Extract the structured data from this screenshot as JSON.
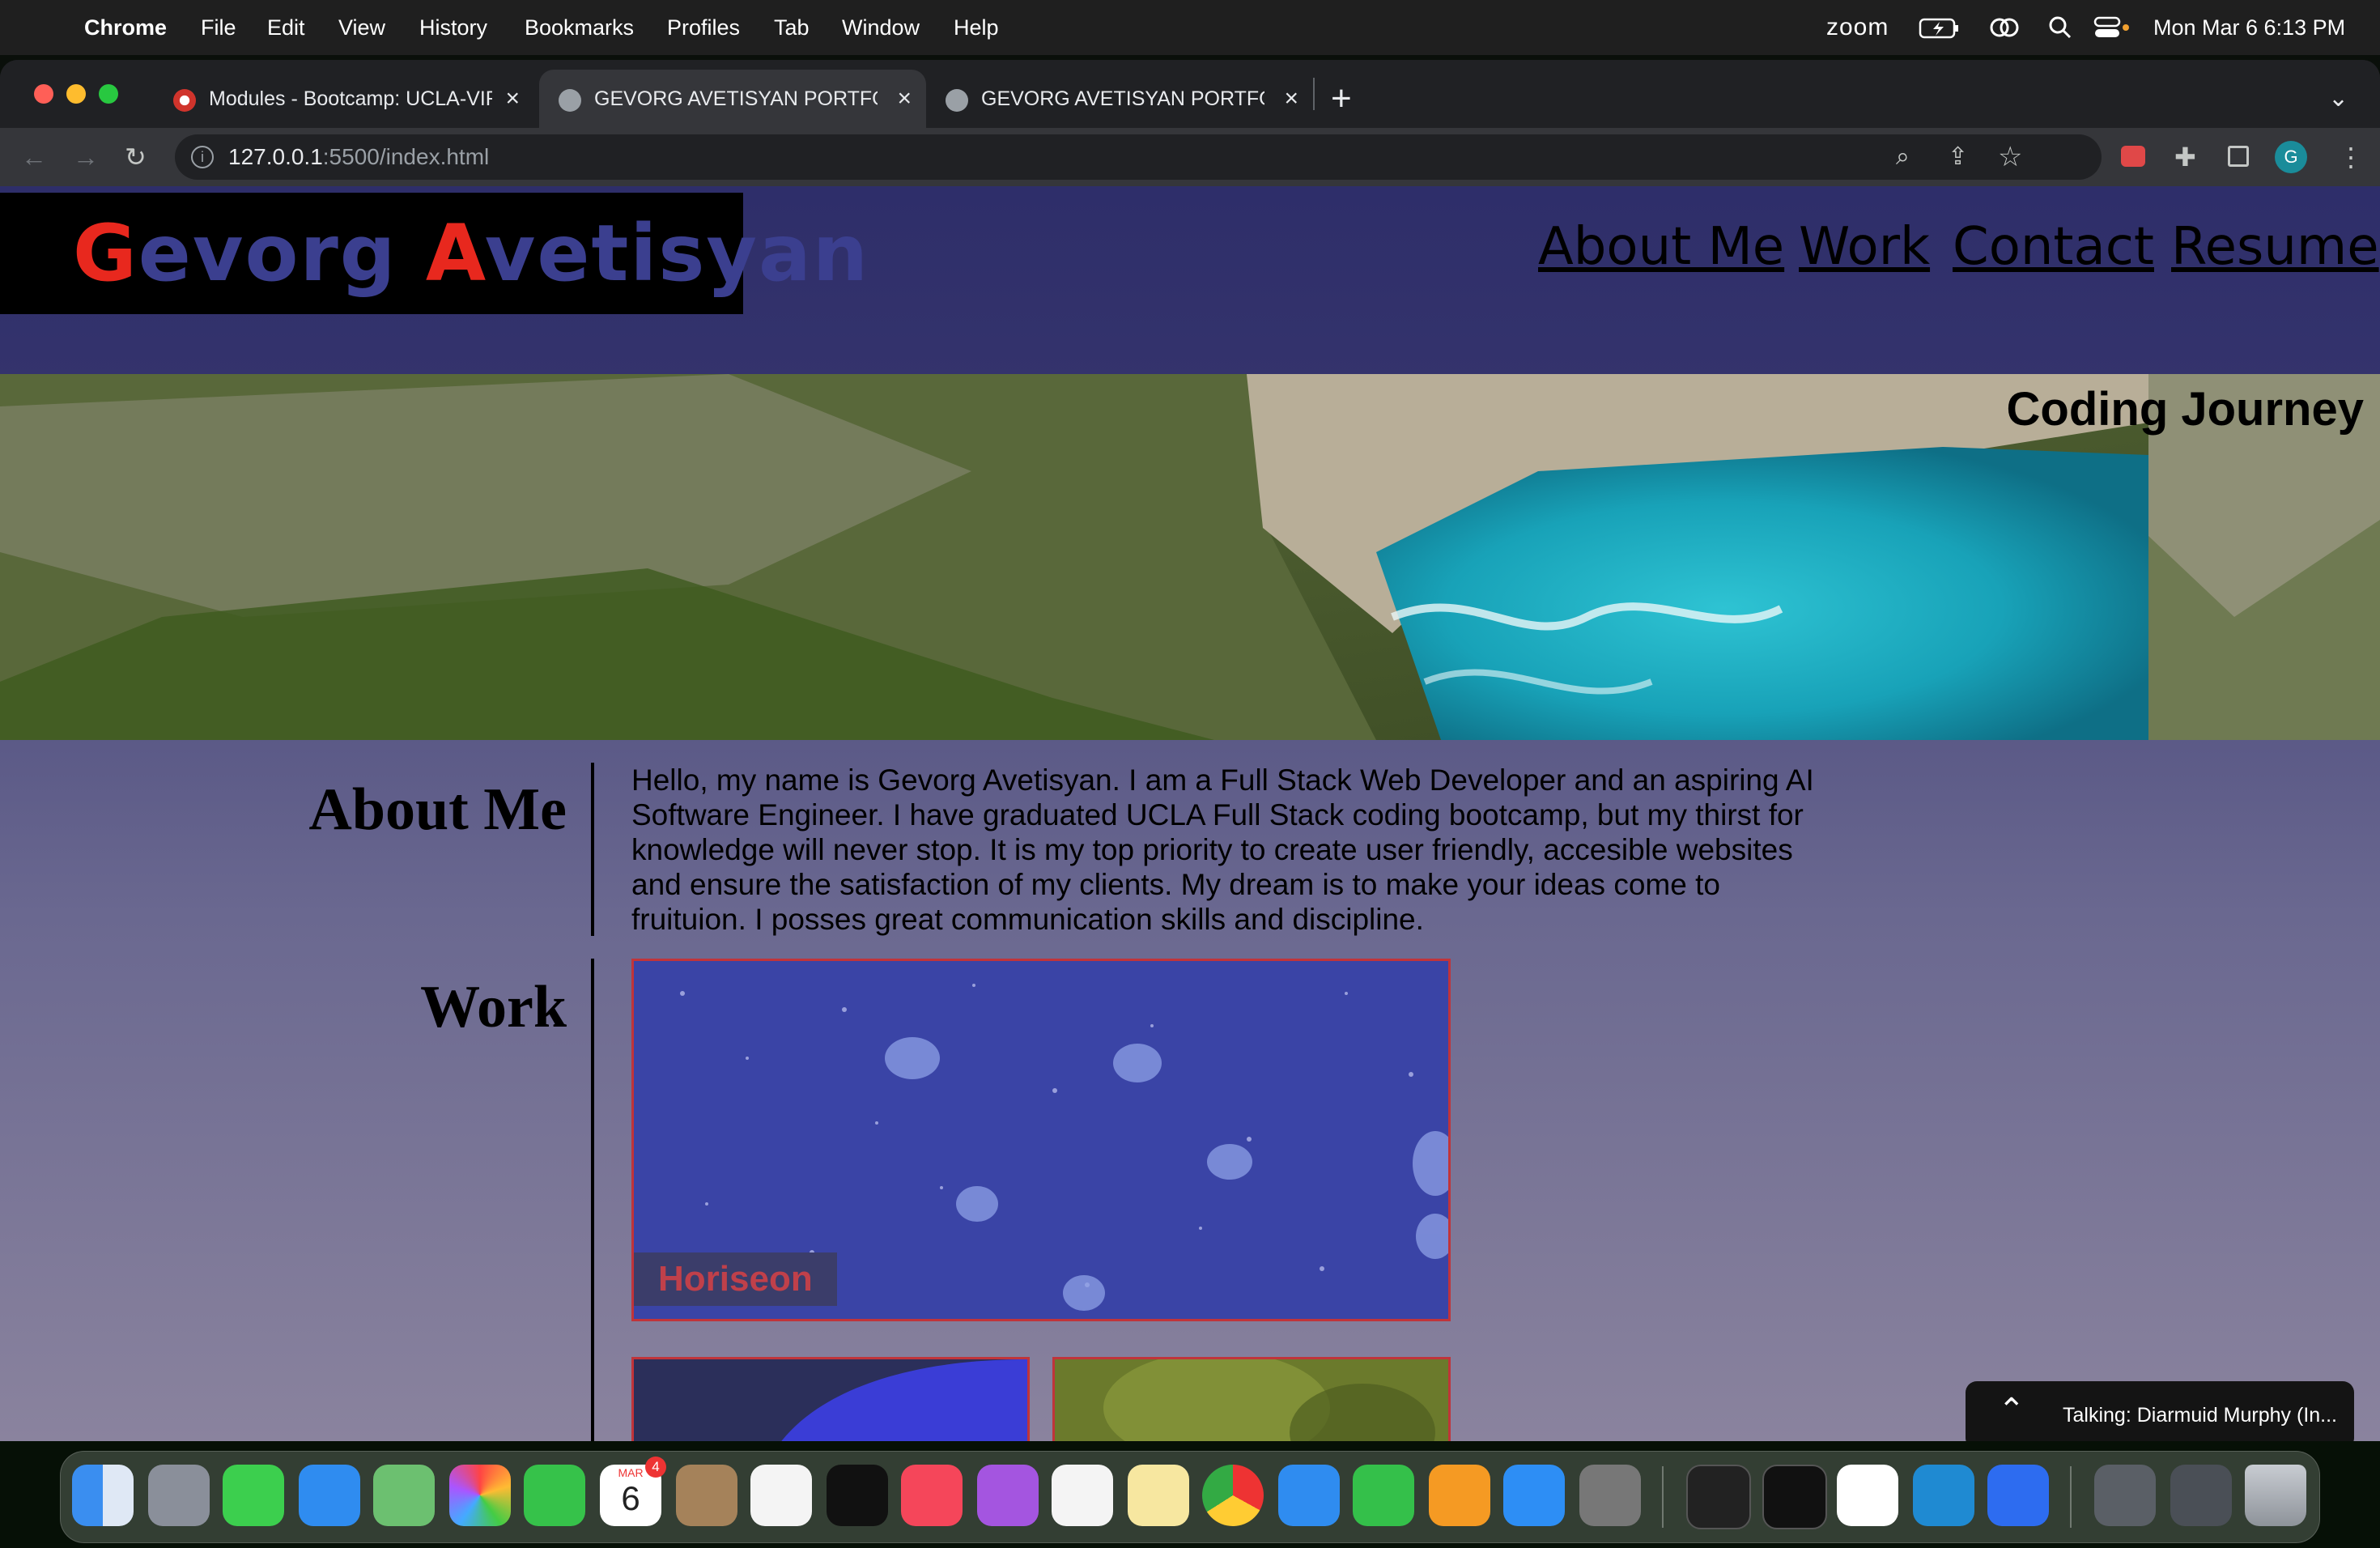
{
  "menubar": {
    "app": "Chrome",
    "items": [
      "File",
      "Edit",
      "View",
      "History",
      "Bookmarks",
      "Profiles",
      "Tab",
      "Window",
      "Help"
    ],
    "zoom_label": "zoom",
    "datetime": "Mon Mar 6  6:13 PM"
  },
  "browser": {
    "tabs": [
      {
        "title": "Modules - Bootcamp: UCLA-VIRT",
        "active": false
      },
      {
        "title": "GEVORG AVETISYAN PORTFOLIO",
        "active": true
      },
      {
        "title": "GEVORG AVETISYAN PORTFOLIO",
        "active": false
      }
    ],
    "new_tab": "+",
    "url_host": "127.0.0.1",
    "url_rest": ":5500/index.html"
  },
  "site": {
    "logo_initial_1": "G",
    "logo_rest_1": "evorg ",
    "logo_initial_2": "A",
    "logo_rest_2": "vetisyan",
    "nav": [
      "About Me",
      "Work",
      "Contact",
      "Resume"
    ],
    "hero_title": "Coding Journey",
    "about_title": "About Me",
    "about_text": "Hello, my name is Gevorg Avetisyan. I am a Full Stack Web Developer and an aspiring AI Software Engineer. I have graduated UCLA Full Stack coding bootcamp, but my thirst for knowledge will never stop. It is my top priority to create user friendly, accesible websites and ensure the satisfaction of my clients. My dream is to make your ideas come to fruituion. I posses great communication skills and discipline.",
    "work_title": "Work",
    "work_card_label": "Horiseon"
  },
  "zoom_notification": {
    "text": "Talking: Diarmuid Murphy (In..."
  },
  "dock": {
    "calendar_month": "MAR",
    "calendar_day": "6",
    "calendar_badge": "4",
    "apps": [
      "finder-icon",
      "launchpad-icon",
      "messages-icon",
      "mail-icon",
      "maps-icon",
      "photos-icon",
      "facetime-icon",
      "calendar-icon",
      "contacts-icon",
      "reminders-icon",
      "apple-tv-icon",
      "music-icon",
      "podcasts-icon",
      "news-icon",
      "notes-icon",
      "chrome-icon",
      "keynote-icon",
      "numbers-icon",
      "pages-icon",
      "app-store-icon",
      "system-settings-icon",
      "activity-monitor-icon",
      "terminal-icon",
      "slack-icon",
      "vscode-icon",
      "zoom-icon",
      "downloads-stack-icon",
      "screenshots-stack-icon",
      "trash-icon"
    ]
  },
  "colors": {
    "logo_red": "#e8281e",
    "logo_blue": "#3b3f8f",
    "card_border": "#c0343a",
    "page_top": "#2e2e6a"
  }
}
